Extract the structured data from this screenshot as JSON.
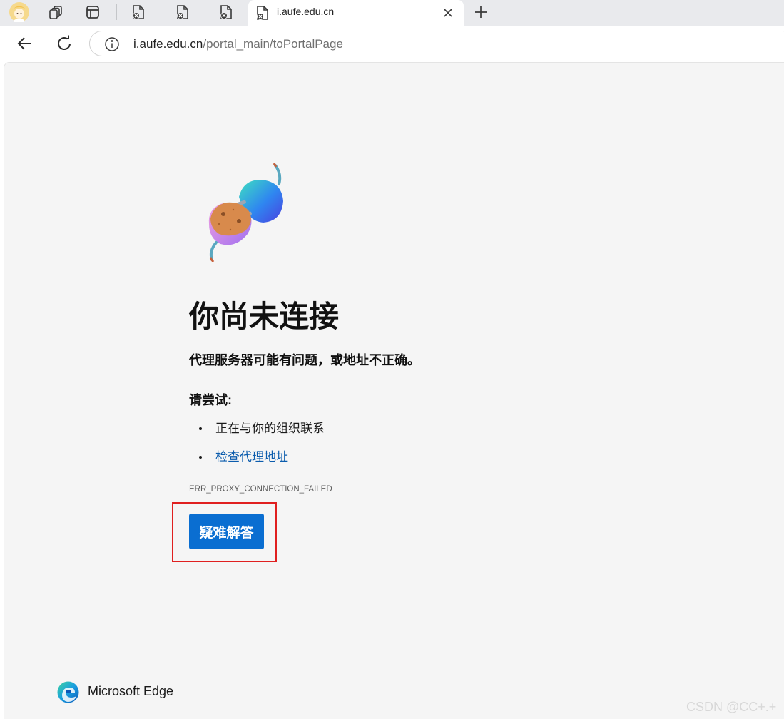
{
  "browser": {
    "tab": {
      "title": "i.aufe.edu.cn"
    },
    "address": {
      "host": "i.aufe.edu.cn",
      "path": "/portal_main/toPortalPage"
    },
    "icons": {
      "profile": "profile-avatar-icon",
      "workspaces": "workspaces-icon",
      "tab_actions": "tab-actions-icon",
      "background_tabs": [
        "page-error-icon",
        "page-error-icon",
        "page-error-icon"
      ],
      "active_tab": "page-error-icon",
      "close_tab": "close-icon",
      "new_tab": "plus-icon",
      "back": "back-arrow-icon",
      "refresh": "refresh-icon",
      "site_info": "info-icon"
    }
  },
  "error_page": {
    "illustration": "unplugged-plug-illustration",
    "title": "你尚未连接",
    "subtitle": "代理服务器可能有问题，或地址不正确。",
    "try_label": "请尝试:",
    "suggestions": [
      {
        "text": "正在与你的组织联系",
        "is_link": false
      },
      {
        "text": "检查代理地址",
        "is_link": true
      }
    ],
    "error_code": "ERR_PROXY_CONNECTION_FAILED",
    "troubleshoot_button": "疑难解答"
  },
  "brand": {
    "name": "Microsoft Edge",
    "logo": "edge-logo-icon"
  },
  "watermark": "CSDN @CC+.+",
  "colors": {
    "button_bg": "#0a6ed1",
    "link": "#0b5cad",
    "highlight_box": "#e02020",
    "page_bg": "#f5f5f5",
    "tabstrip_bg": "#e9eaed"
  }
}
